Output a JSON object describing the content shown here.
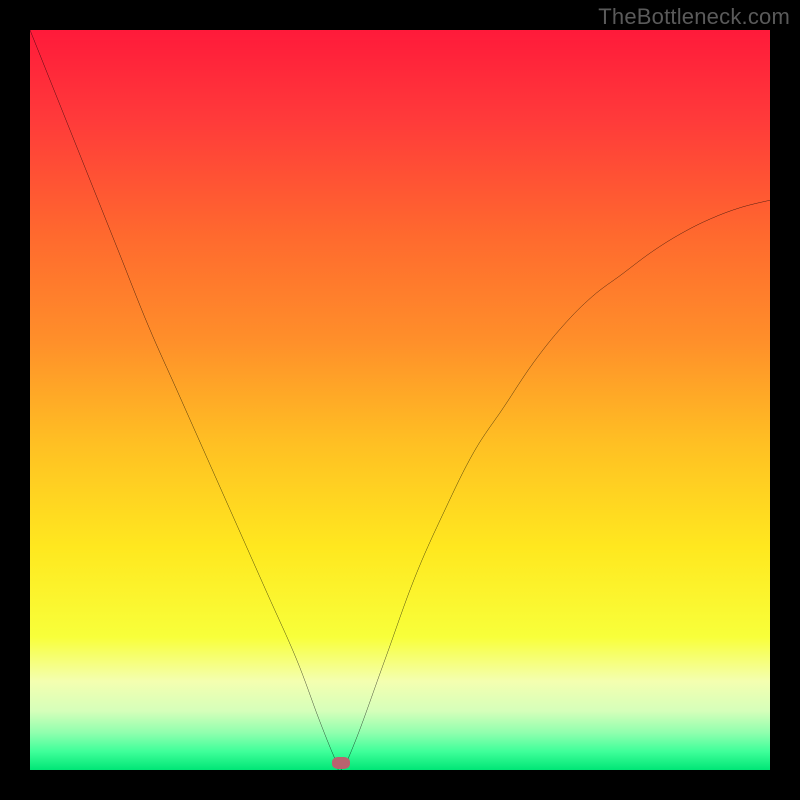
{
  "watermark": "TheBottleneck.com",
  "chart_data": {
    "type": "line",
    "title": "",
    "xlabel": "",
    "ylabel": "",
    "xlim": [
      0,
      100
    ],
    "ylim": [
      0,
      100
    ],
    "grid": false,
    "legend": false,
    "marker": {
      "x": 42,
      "y": 1
    },
    "series": [
      {
        "name": "curve",
        "x": [
          0,
          4,
          8,
          12,
          16,
          20,
          24,
          28,
          32,
          36,
          39,
          41,
          42,
          44,
          48,
          52,
          56,
          60,
          64,
          68,
          72,
          76,
          80,
          84,
          88,
          92,
          96,
          100
        ],
        "values": [
          100,
          90,
          80,
          70,
          60,
          51,
          42,
          33,
          24,
          15,
          7,
          2,
          0,
          4,
          15,
          26,
          35,
          43,
          49,
          55,
          60,
          64,
          67,
          70,
          72.5,
          74.5,
          76,
          77
        ]
      }
    ],
    "gradient_stops": [
      {
        "pct": 0,
        "color": "#ff1a3a"
      },
      {
        "pct": 12,
        "color": "#ff3a3a"
      },
      {
        "pct": 28,
        "color": "#ff6a2e"
      },
      {
        "pct": 42,
        "color": "#ff8f2a"
      },
      {
        "pct": 56,
        "color": "#ffc023"
      },
      {
        "pct": 70,
        "color": "#ffe81f"
      },
      {
        "pct": 82,
        "color": "#f8ff3a"
      },
      {
        "pct": 88,
        "color": "#f4ffb0"
      },
      {
        "pct": 92,
        "color": "#d6ffba"
      },
      {
        "pct": 95,
        "color": "#8fffae"
      },
      {
        "pct": 97.5,
        "color": "#3fff9a"
      },
      {
        "pct": 100,
        "color": "#00e676"
      }
    ]
  }
}
